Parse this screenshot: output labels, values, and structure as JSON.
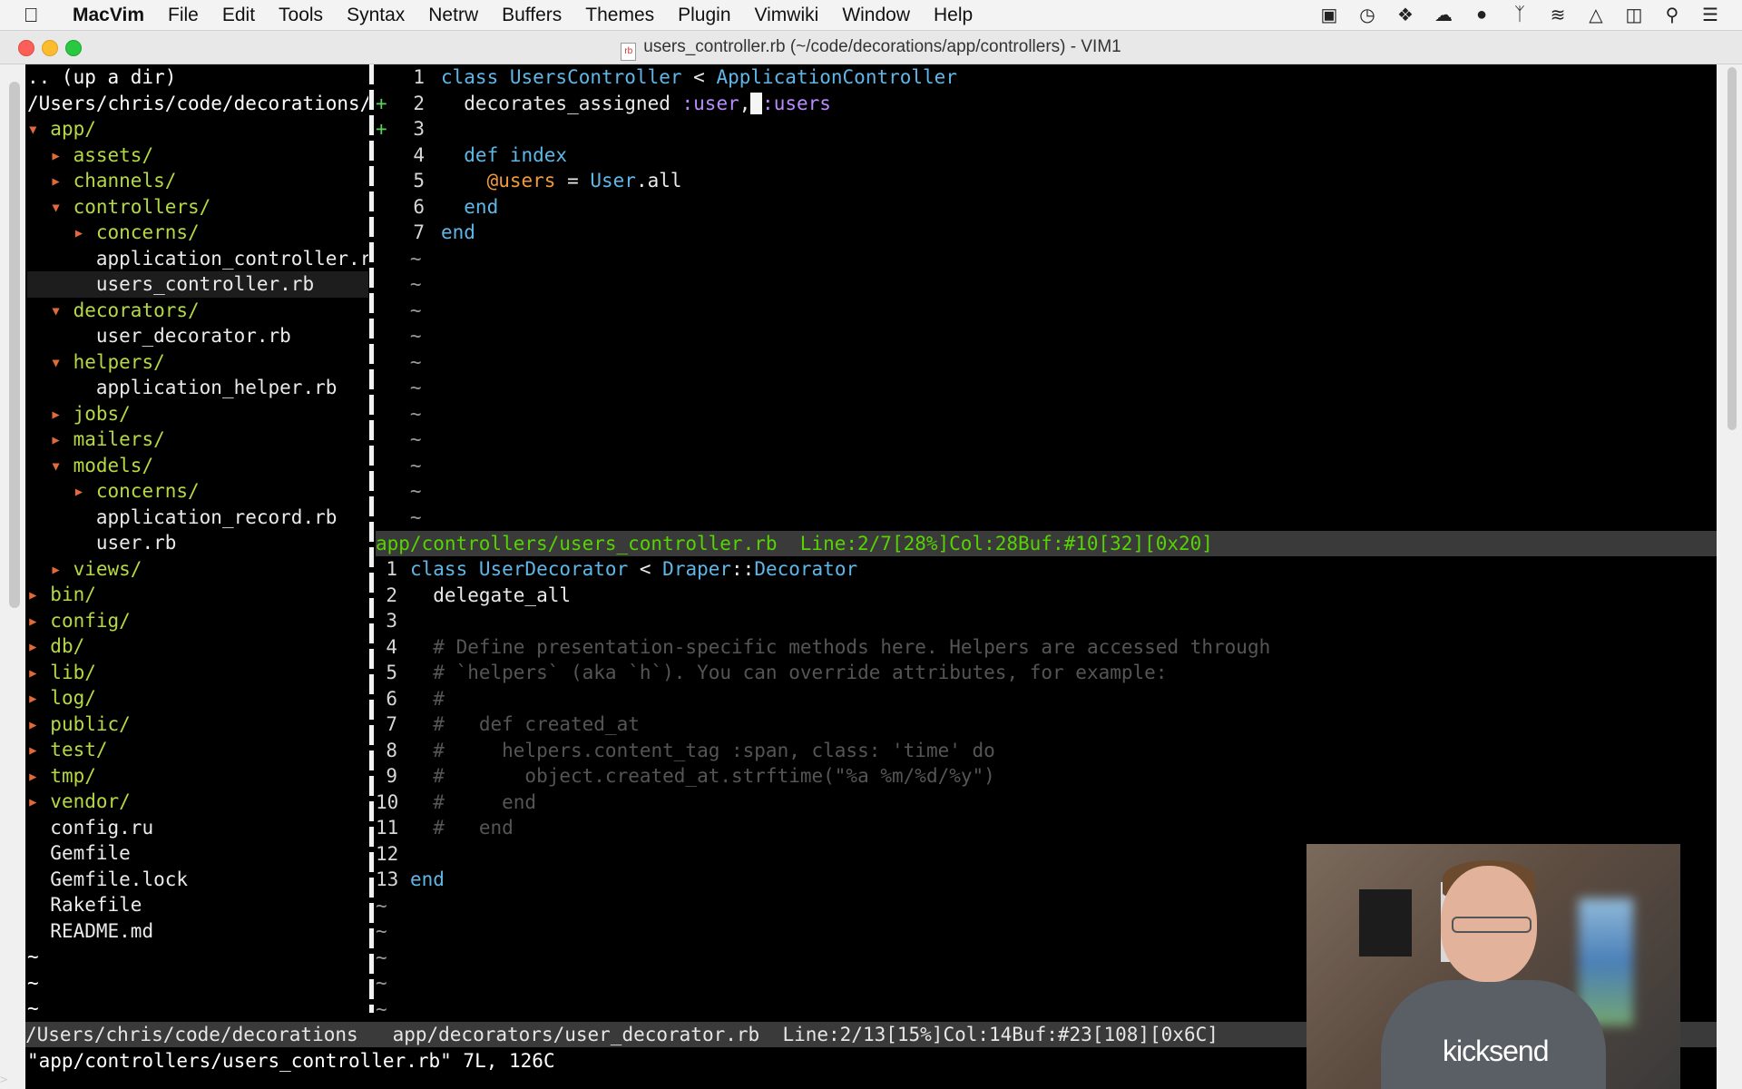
{
  "menubar": {
    "app": "MacVim",
    "items": [
      "File",
      "Edit",
      "Tools",
      "Syntax",
      "Netrw",
      "Buffers",
      "Themes",
      "Plugin",
      "Vimwiki",
      "Window",
      "Help"
    ]
  },
  "window": {
    "title": "users_controller.rb (~/code/decorations/app/controllers) - VIM1",
    "doc_icon": "rb"
  },
  "tree": {
    "up": ".. (up a dir)",
    "root": "/Users/chris/code/decorations/",
    "entries": [
      {
        "indent": 0,
        "arrow": "down",
        "name": "app/",
        "dir": true
      },
      {
        "indent": 1,
        "arrow": "right",
        "name": "assets/",
        "dir": true
      },
      {
        "indent": 1,
        "arrow": "right",
        "name": "channels/",
        "dir": true
      },
      {
        "indent": 1,
        "arrow": "down",
        "name": "controllers/",
        "dir": true
      },
      {
        "indent": 2,
        "arrow": "right",
        "name": "concerns/",
        "dir": true
      },
      {
        "indent": 2,
        "arrow": "",
        "name": "application_controller.rb",
        "dir": false
      },
      {
        "indent": 2,
        "arrow": "",
        "name": "users_controller.rb",
        "dir": false,
        "selected": true
      },
      {
        "indent": 1,
        "arrow": "down",
        "name": "decorators/",
        "dir": true
      },
      {
        "indent": 2,
        "arrow": "",
        "name": "user_decorator.rb",
        "dir": false
      },
      {
        "indent": 1,
        "arrow": "down",
        "name": "helpers/",
        "dir": true
      },
      {
        "indent": 2,
        "arrow": "",
        "name": "application_helper.rb",
        "dir": false
      },
      {
        "indent": 1,
        "arrow": "right",
        "name": "jobs/",
        "dir": true
      },
      {
        "indent": 1,
        "arrow": "right",
        "name": "mailers/",
        "dir": true
      },
      {
        "indent": 1,
        "arrow": "down",
        "name": "models/",
        "dir": true
      },
      {
        "indent": 2,
        "arrow": "right",
        "name": "concerns/",
        "dir": true
      },
      {
        "indent": 2,
        "arrow": "",
        "name": "application_record.rb",
        "dir": false
      },
      {
        "indent": 2,
        "arrow": "",
        "name": "user.rb",
        "dir": false
      },
      {
        "indent": 1,
        "arrow": "right",
        "name": "views/",
        "dir": true
      },
      {
        "indent": 0,
        "arrow": "right",
        "name": "bin/",
        "dir": true
      },
      {
        "indent": 0,
        "arrow": "right",
        "name": "config/",
        "dir": true
      },
      {
        "indent": 0,
        "arrow": "right",
        "name": "db/",
        "dir": true
      },
      {
        "indent": 0,
        "arrow": "right",
        "name": "lib/",
        "dir": true
      },
      {
        "indent": 0,
        "arrow": "right",
        "name": "log/",
        "dir": true
      },
      {
        "indent": 0,
        "arrow": "right",
        "name": "public/",
        "dir": true
      },
      {
        "indent": 0,
        "arrow": "right",
        "name": "test/",
        "dir": true
      },
      {
        "indent": 0,
        "arrow": "right",
        "name": "tmp/",
        "dir": true
      },
      {
        "indent": 0,
        "arrow": "right",
        "name": "vendor/",
        "dir": true
      },
      {
        "indent": 0,
        "arrow": "",
        "name": "config.ru",
        "dir": false
      },
      {
        "indent": 0,
        "arrow": "",
        "name": "Gemfile",
        "dir": false
      },
      {
        "indent": 0,
        "arrow": "",
        "name": "Gemfile.lock",
        "dir": false
      },
      {
        "indent": 0,
        "arrow": "",
        "name": "Rakefile",
        "dir": false
      },
      {
        "indent": 0,
        "arrow": "",
        "name": "README.md",
        "dir": false
      }
    ],
    "tildes": 3
  },
  "buffer1": {
    "lines": [
      {
        "n": "1",
        "sign": "",
        "tokens": [
          [
            "kw",
            "class "
          ],
          [
            "ty",
            "UsersController"
          ],
          [
            "tx",
            " < "
          ],
          [
            "ty",
            "ApplicationController"
          ]
        ]
      },
      {
        "n": "2",
        "sign": "+",
        "tokens": [
          [
            "tx",
            "  decorates_assigned "
          ],
          [
            "sym",
            ":user"
          ],
          [
            "tx",
            ","
          ],
          [
            "cur",
            " "
          ],
          [
            "sym",
            ":users"
          ]
        ]
      },
      {
        "n": "3",
        "sign": "+",
        "tokens": []
      },
      {
        "n": "4",
        "sign": "",
        "tokens": [
          [
            "kw",
            "  def "
          ],
          [
            "ty",
            "index"
          ]
        ]
      },
      {
        "n": "5",
        "sign": "",
        "tokens": [
          [
            "iv",
            "    @users"
          ],
          [
            "tx",
            " = "
          ],
          [
            "ty",
            "User"
          ],
          [
            "tx",
            ".all"
          ]
        ]
      },
      {
        "n": "6",
        "sign": "",
        "tokens": [
          [
            "kw",
            "  end"
          ]
        ]
      },
      {
        "n": "7",
        "sign": "",
        "tokens": [
          [
            "kw",
            "end"
          ]
        ]
      }
    ],
    "tildes": 11
  },
  "status1": "app/controllers/users_controller.rb  Line:2/7[28%]Col:28Buf:#10[32][0x20]",
  "buffer2": {
    "lines": [
      {
        "n": "1",
        "tokens": [
          [
            "kw",
            "class "
          ],
          [
            "ty",
            "UserDecorator"
          ],
          [
            "tx",
            " < "
          ],
          [
            "ty",
            "Draper"
          ],
          [
            "tx",
            "::"
          ],
          [
            "ty",
            "Decorator"
          ]
        ]
      },
      {
        "n": "2",
        "tokens": [
          [
            "tx",
            "  delegate_all"
          ]
        ]
      },
      {
        "n": "3",
        "tokens": []
      },
      {
        "n": "4",
        "tokens": [
          [
            "cm",
            "  # Define presentation-specific methods here. Helpers are accessed through"
          ]
        ]
      },
      {
        "n": "5",
        "tokens": [
          [
            "cm",
            "  # `helpers` (aka `h`). You can override attributes, for example:"
          ]
        ]
      },
      {
        "n": "6",
        "tokens": [
          [
            "cm",
            "  #"
          ]
        ]
      },
      {
        "n": "7",
        "tokens": [
          [
            "cm",
            "  #   def created_at"
          ]
        ]
      },
      {
        "n": "8",
        "tokens": [
          [
            "cm",
            "  #     helpers.content_tag :span, class: 'time' do"
          ]
        ]
      },
      {
        "n": "9",
        "tokens": [
          [
            "cm",
            "  #       object.created_at.strftime(\"%a %m/%d/%y\")"
          ]
        ]
      },
      {
        "n": "10",
        "tokens": [
          [
            "cm",
            "  #     end"
          ]
        ]
      },
      {
        "n": "11",
        "tokens": [
          [
            "cm",
            "  #   end"
          ]
        ]
      },
      {
        "n": "12",
        "tokens": []
      },
      {
        "n": "13",
        "tokens": [
          [
            "kw",
            "end"
          ]
        ]
      }
    ],
    "tildes": 5
  },
  "status_bottom": "/Users/chris/code/decorations   app/decorators/user_decorator.rb  Line:2/13[15%]Col:14Buf:#23[108][0x6C]",
  "cmdline": "\"app/controllers/users_controller.rb\" 7L, 126C",
  "cmdprompt": ">",
  "tilde": "~",
  "webcam": {
    "shirt_text": "kicksend"
  },
  "colors": {
    "tree_dir": "#b5d943",
    "tree_root": "#ff2e63",
    "status_green": "#55d400",
    "keyword": "#5fb7e8",
    "symbol": "#b98bff",
    "ivar": "#f29a3a"
  }
}
